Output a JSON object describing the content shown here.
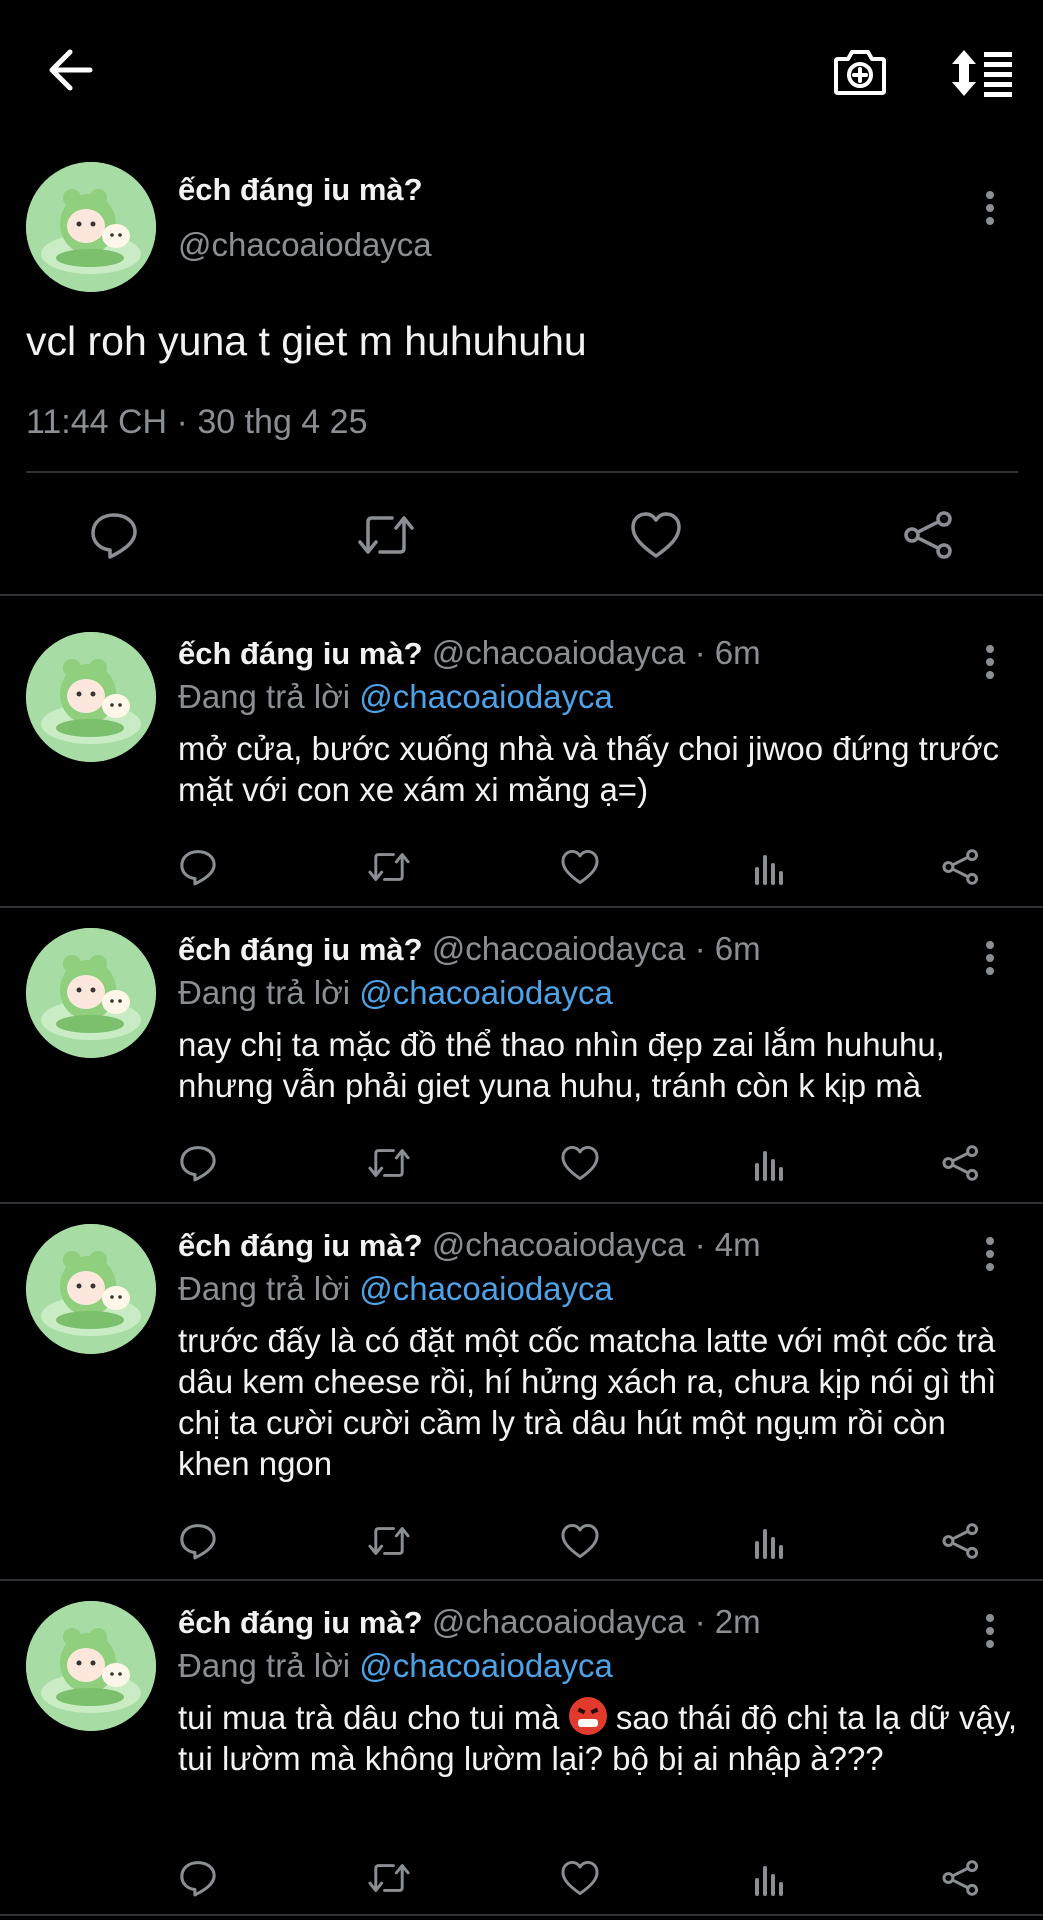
{
  "header": {
    "back_icon": "arrow-left-icon",
    "camera_icon": "camera-plus-icon",
    "sort_icon": "sort-list-icon"
  },
  "main_tweet": {
    "display_name": "ếch đáng iu mà?",
    "handle": "@chacoaiodayca",
    "text": "vcl roh yuna t giet m huhuhuhu",
    "timestamp": "11:44 CH · 30 thg 4 25",
    "actions": [
      "reply-icon",
      "retweet-icon",
      "like-icon",
      "share-icon"
    ]
  },
  "replies": [
    {
      "display_name": "ếch đáng iu mà?",
      "handle": "@chacoaiodayca",
      "sep": "·",
      "time": "6m",
      "reply_prefix": "Đang trả lời",
      "reply_to": "@chacoaiodayca",
      "text": "mở cửa, bước xuống nhà và thấy choi jiwoo đứng trước mặt với con xe xám xi măng ạ=)"
    },
    {
      "display_name": "ếch đáng iu mà?",
      "handle": "@chacoaiodayca",
      "sep": "·",
      "time": "6m",
      "reply_prefix": "Đang trả lời",
      "reply_to": "@chacoaiodayca",
      "text": "nay chị ta mặc đồ thể thao nhìn đẹp zai lắm huhuhu, nhưng vẫn phải giet yuna huhu, tránh còn k kịp mà"
    },
    {
      "display_name": "ếch đáng iu mà?",
      "handle": "@chacoaiodayca",
      "sep": "·",
      "time": "4m",
      "reply_prefix": "Đang trả lời",
      "reply_to": "@chacoaiodayca",
      "text": "trước đấy là có đặt một cốc matcha latte với một cốc trà dâu kem cheese rồi, hí hửng xách ra, chưa kịp nói gì thì chị ta cười cười cầm ly trà dâu hút một ngụm rồi còn khen ngon"
    },
    {
      "display_name": "ếch đáng iu mà?",
      "handle": "@chacoaiodayca",
      "sep": "·",
      "time": "2m",
      "reply_prefix": "Đang trả lời",
      "reply_to": "@chacoaiodayca",
      "text_before_emoji": "tui mua trà dâu cho tui mà",
      "emoji": "angry-cursing-face-emoji",
      "text_after_emoji": "sao thái độ chị ta lạ dữ vậy, tui lườm mà không lườm lại? bộ bị ai nhập à???"
    }
  ],
  "colors": {
    "background": "#000000",
    "text": "#f2f2f2",
    "muted": "#8b8f94",
    "mention": "#4ea2e6",
    "divider": "#2f3336",
    "avatar_bg": "#a8dca5"
  }
}
